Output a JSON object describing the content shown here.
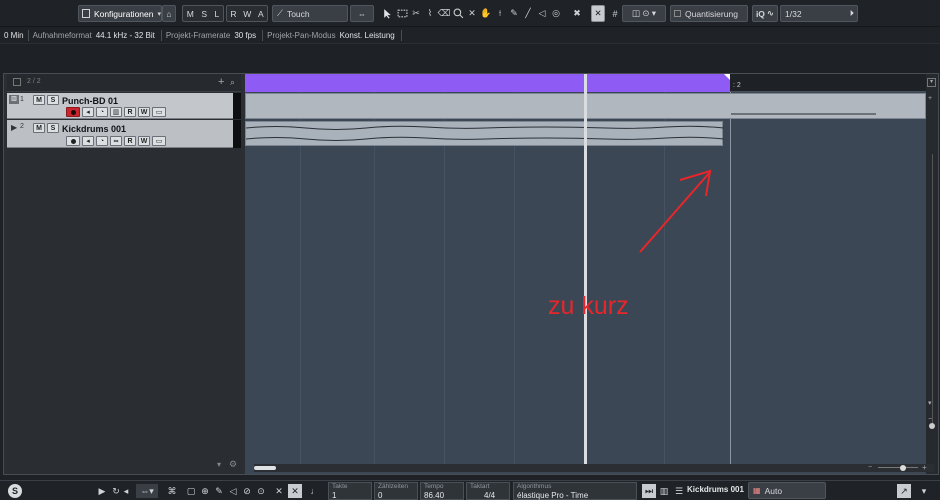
{
  "toolbar": {
    "configurations_label": "Konfigurationen",
    "mode_letters": [
      "M",
      "S",
      "L",
      "R",
      "W",
      "A"
    ],
    "automation_mode": "Touch",
    "quantize_label": "Quantisierung",
    "iq_label": "iQ",
    "quantize_value": "1/32"
  },
  "infobar": {
    "items": [
      {
        "label": "0 Min",
        "value": ""
      },
      {
        "label": "Aufnahmeformat",
        "value": "44.1 kHz - 32 Bit"
      },
      {
        "label": "Projekt-Framerate",
        "value": "30 fps"
      },
      {
        "label": "Projekt-Pan-Modus",
        "value": "Konst. Leistung"
      }
    ]
  },
  "tracklist": {
    "count": "2 / 2",
    "tracks": [
      {
        "number": "1",
        "name": "Punch-BD 01",
        "type": "instrument"
      },
      {
        "number": "2",
        "name": "Kickdrums 001",
        "type": "audio"
      }
    ],
    "buttons": {
      "mute": "M",
      "solo": "S",
      "read": "R",
      "write": "W"
    }
  },
  "ruler": {
    "marker": "2"
  },
  "annotation": {
    "text": "zu kurz",
    "color": "#e8262a"
  },
  "transport": {
    "takte": {
      "label": "Takte",
      "value": "1"
    },
    "zaehlzeiten": {
      "label": "Zählzeiten",
      "value": "0"
    },
    "tempo": {
      "label": "Tempo",
      "value": "86.40"
    },
    "taktart": {
      "label": "Taktart",
      "value": "4/4"
    },
    "algorithmus": {
      "label": "Algorithmus",
      "value": "élastique Pro - Time"
    },
    "selected_track": "Kickdrums 001",
    "mode": "Auto"
  },
  "colors": {
    "cycle": "#8e5cf5",
    "event_bg": "#3b4755",
    "record": "#c9252c"
  }
}
